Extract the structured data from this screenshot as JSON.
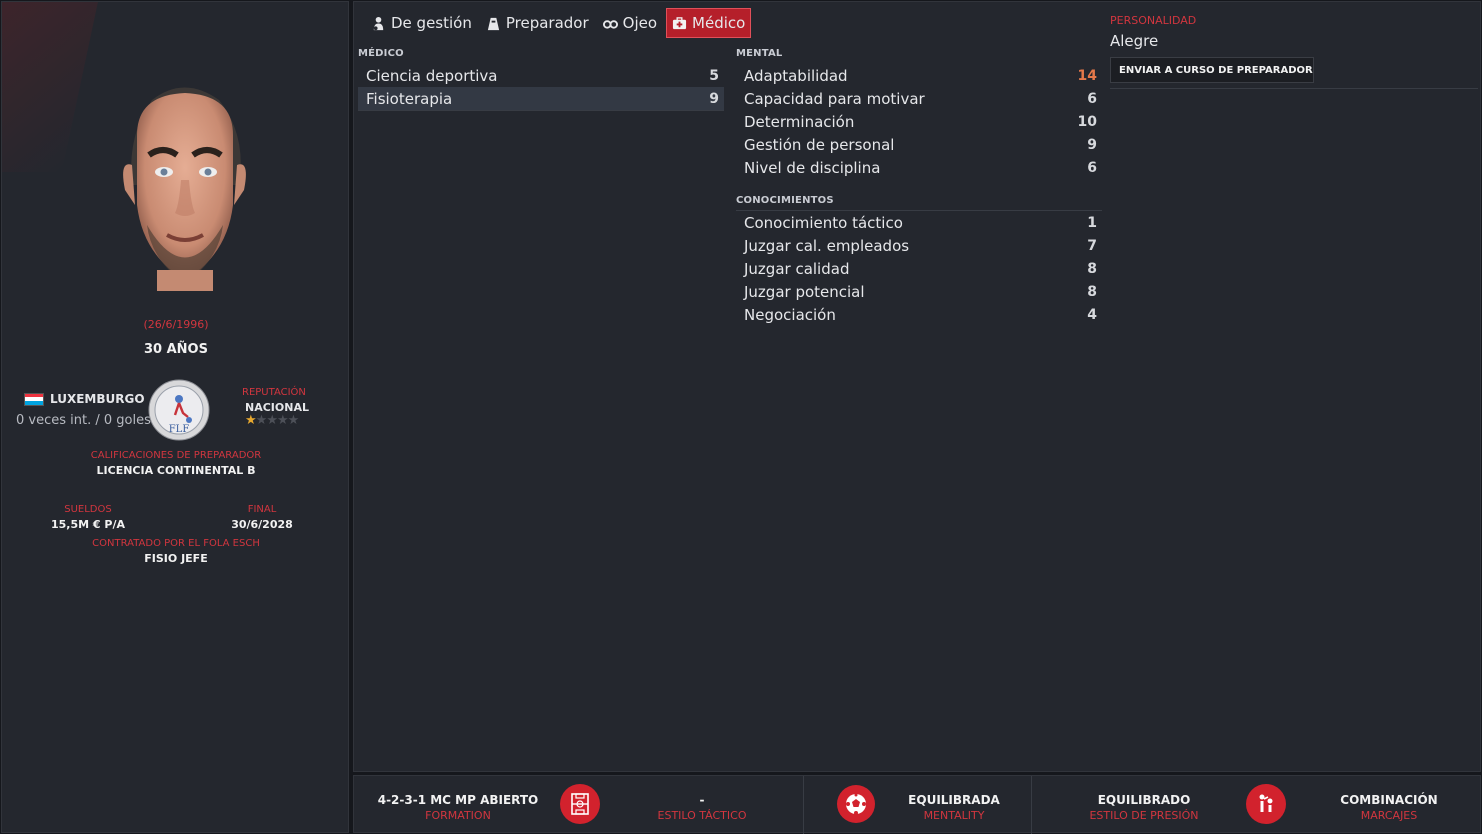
{
  "profile": {
    "dob": "(26/6/1996)",
    "age": "30 AÑOS",
    "nation": "LUXEMBURGO",
    "caps": "0 veces int. / 0 goles",
    "badge_text": "FLF",
    "reputation_label": "REPUTACIÓN",
    "reputation_value": "NACIONAL",
    "reputation_stars": 1,
    "reputation_max": 5,
    "qualifications_label": "CALIFICACIONES DE PREPARADOR",
    "qualifications_value": "LICENCIA CONTINENTAL B",
    "wage_label": "SUELDOS",
    "wage_value": "15,5M € P/A",
    "contract_end_label": "FINAL",
    "contract_end_value": "30/6/2028",
    "employer_label": "CONTRATADO POR EL FOLA ESCH",
    "role": "FISIO JEFE",
    "flag_colors": [
      "#ef3340",
      "#ffffff",
      "#00a3e0"
    ]
  },
  "tabs": [
    {
      "label": "De gestión",
      "icon": "manager-icon",
      "active": false
    },
    {
      "label": "Preparador",
      "icon": "coach-icon",
      "active": false
    },
    {
      "label": "Ojeo",
      "icon": "binoculars-icon",
      "active": false
    },
    {
      "label": "Médico",
      "icon": "medical-kit-icon",
      "active": true
    }
  ],
  "medical": {
    "label": "MÉDICO",
    "attributes": [
      {
        "name": "Ciencia deportiva",
        "value": "5"
      },
      {
        "name": "Fisioterapia",
        "value": "9"
      }
    ]
  },
  "mental": {
    "label": "MENTAL",
    "attributes": [
      {
        "name": "Adaptabilidad",
        "value": "14"
      },
      {
        "name": "Capacidad para motivar",
        "value": "6"
      },
      {
        "name": "Determinación",
        "value": "10"
      },
      {
        "name": "Gestión de personal",
        "value": "9"
      },
      {
        "name": "Nivel de disciplina",
        "value": "6"
      }
    ]
  },
  "knowledge": {
    "label": "CONOCIMIENTOS",
    "attributes": [
      {
        "name": "Conocimiento táctico",
        "value": "1"
      },
      {
        "name": "Juzgar cal. empleados",
        "value": "7"
      },
      {
        "name": "Juzgar calidad",
        "value": "8"
      },
      {
        "name": "Juzgar potencial",
        "value": "8"
      },
      {
        "name": "Negociación",
        "value": "4"
      }
    ]
  },
  "personality": {
    "label": "PERSONALIDAD",
    "value": "Alegre",
    "button": "ENVIAR A CURSO DE PREPARADOR"
  },
  "bottom": {
    "formation_value": "4-2-3-1 MC MP ABIERTO",
    "formation_label": "FORMATION",
    "tactical_style_value": "-",
    "tactical_style_label": "ESTILO TÁCTICO",
    "mentality_value": "EQUILIBRADA",
    "mentality_label": "MENTALITY",
    "pressing_value": "EQUILIBRADO",
    "pressing_label": "ESTILO DE PRESIÓN",
    "marking_value": "COMBINACIÓN",
    "marking_label": "MARCAJES"
  },
  "colors": {
    "accent": "#d2222d",
    "highlight_value": "#e6794a",
    "star": "#e8a92f"
  }
}
